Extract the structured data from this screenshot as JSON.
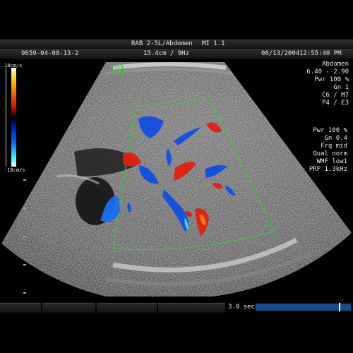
{
  "header": {
    "probe_preset": "RAB 2-5L/Abdomen",
    "mi": "MI  1.1",
    "patient_id": "9659-04-08-13-2",
    "depth_freq": "15.4cm / 9Hz",
    "date": "08/13/2004",
    "time": "12:55:40 PM"
  },
  "velocity_scale": {
    "top_label": "18cm/s",
    "bottom_label": "-18cm/s"
  },
  "params_2d": [
    "Abdomen",
    "6.40 - 2.90",
    "Pwr 100 %",
    "Gn  1",
    "C6 / M7",
    "P4 / E3"
  ],
  "params_color": [
    "Pwr 100 %",
    "Gn 0.4",
    "Frq mid",
    "Qual norm",
    "WMF low1",
    "PRF  1.3kHz"
  ],
  "footer": {
    "time_scale": "3.0 sec"
  },
  "colors": {
    "doppler_red": "#e02010",
    "doppler_blue": "#1050e0",
    "roi_box": "#3ac83a",
    "timebar": "#1a4a8a"
  }
}
